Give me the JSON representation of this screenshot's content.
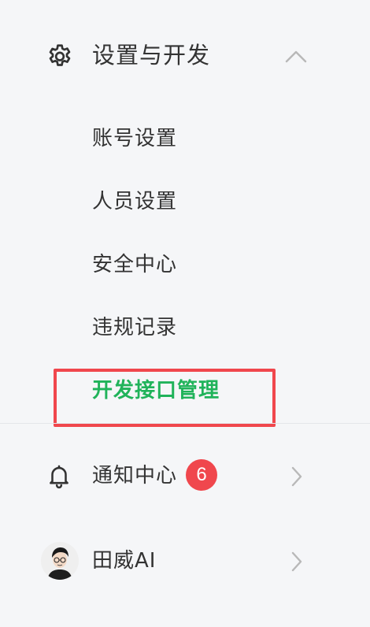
{
  "section": {
    "title": "设置与开发",
    "icon": "gear-icon",
    "collapse_icon": "chevron-up-icon",
    "items": [
      {
        "label": "账号设置",
        "active": false
      },
      {
        "label": "人员设置",
        "active": false
      },
      {
        "label": "安全中心",
        "active": false
      },
      {
        "label": "违规记录",
        "active": false
      },
      {
        "label": "开发接口管理",
        "active": true
      }
    ]
  },
  "notifications": {
    "label": "通知中心",
    "badge": "6",
    "icon": "bell-icon",
    "arrow": "chevron-right-icon"
  },
  "user": {
    "name": "田威AI",
    "avatar": "avatar",
    "arrow": "chevron-right-icon"
  },
  "colors": {
    "accent": "#20b35a",
    "badge": "#f0474d",
    "highlight_border": "#f0474d",
    "background": "#f5f6f8"
  }
}
